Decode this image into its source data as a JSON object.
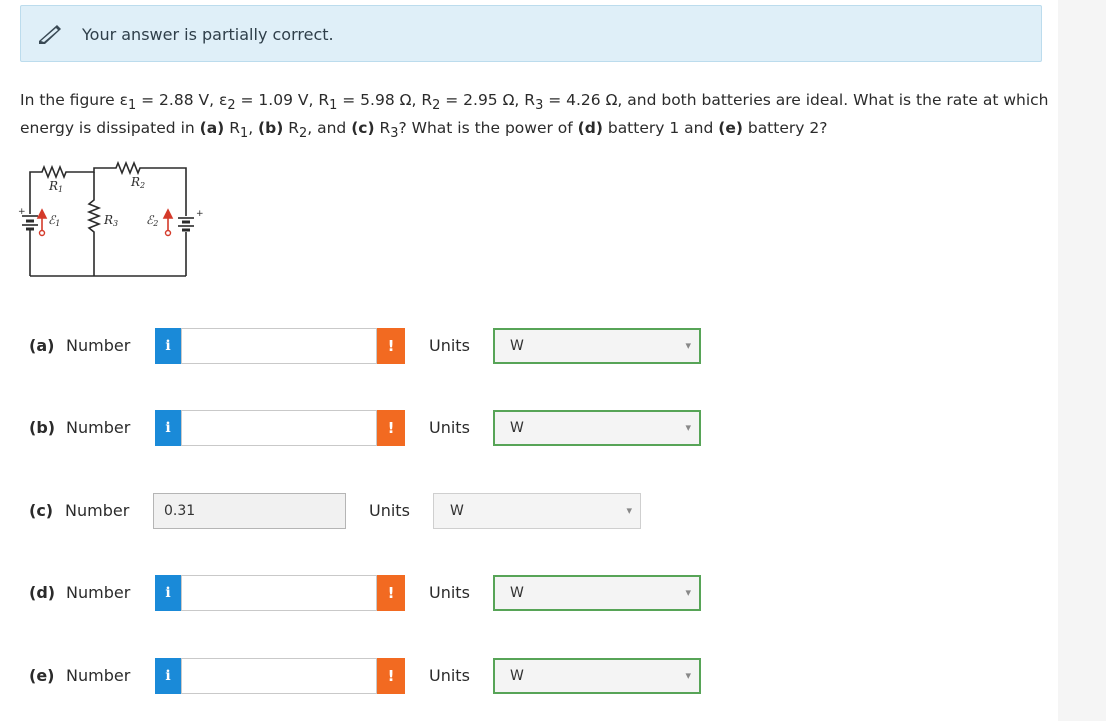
{
  "banner": {
    "icon": "pencil-icon",
    "message": "Your answer is partially correct."
  },
  "question": {
    "intro": "In the figure ",
    "emf1": "ε",
    "emf1_sub": "1",
    "emf1_val": " = 2.88 V, ",
    "emf2": "ε",
    "emf2_sub": "2",
    "emf2_val": " = 1.09 V, ",
    "r1": "R",
    "r1_sub": "1",
    "r1_val": " = 5.98 Ω, ",
    "r2": "R",
    "r2_sub": "2",
    "r2_val": " = 2.95 Ω, ",
    "r3": "R",
    "r3_sub": "3",
    "r3_val": " = 4.26 Ω, and both batteries are ideal. What is the rate at which energy is dissipated in ",
    "pa": "(a)",
    "pa_txt": " R",
    "pa_sub": "1",
    "pa_end": ", ",
    "pb": "(b)",
    "pb_txt": " R",
    "pb_sub": "2",
    "pb_end": ", and ",
    "pc": "(c)",
    "pc_txt": " R",
    "pc_sub": "3",
    "pc_end": "? What is the power of ",
    "pd": "(d)",
    "pd_txt": " battery 1 and ",
    "pe": "(e)",
    "pe_txt": " battery 2?"
  },
  "figure": {
    "r1_label": "R",
    "r1_sub": "1",
    "r2_label": "R",
    "r2_sub": "2",
    "r3_label": "R",
    "r3_sub": "3",
    "e1_label": "ℰ",
    "e1_sub": "1",
    "e2_label": "ℰ",
    "e2_sub": "2",
    "plus": "+"
  },
  "answers": [
    {
      "part": "(a)",
      "number_label": "Number",
      "info": "i",
      "value": "",
      "warn": "!",
      "units_label": "Units",
      "unit": "W"
    },
    {
      "part": "(b)",
      "number_label": "Number",
      "info": "i",
      "value": "",
      "warn": "!",
      "units_label": "Units",
      "unit": "W"
    },
    {
      "part": "(c)",
      "number_label": "Number",
      "info": "",
      "value": "0.31",
      "warn": "",
      "units_label": "Units",
      "unit": "W"
    },
    {
      "part": "(d)",
      "number_label": "Number",
      "info": "i",
      "value": "",
      "warn": "!",
      "units_label": "Units",
      "unit": "W"
    },
    {
      "part": "(e)",
      "number_label": "Number",
      "info": "i",
      "value": "",
      "warn": "!",
      "units_label": "Units",
      "unit": "W"
    }
  ],
  "colors": {
    "info": "#1a8ad8",
    "warn": "#f26a21",
    "correct_border": "#57a457",
    "banner_bg": "#dfeff8"
  }
}
